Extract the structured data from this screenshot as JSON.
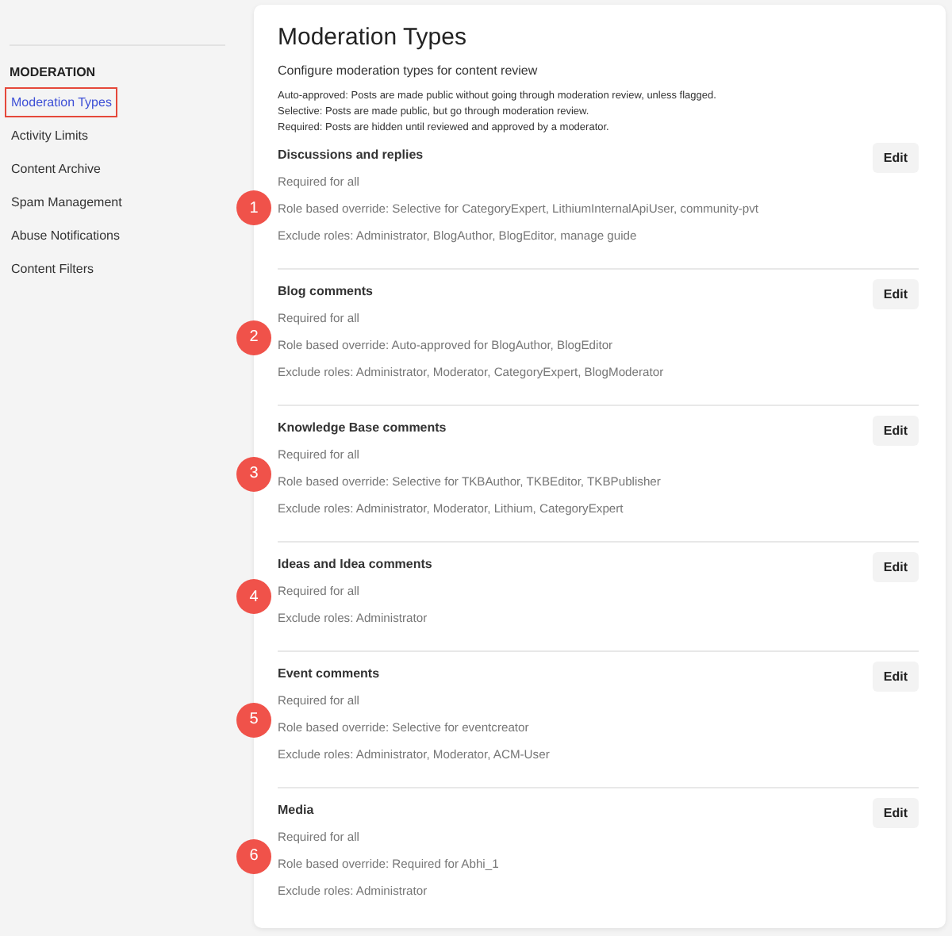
{
  "sidebar": {
    "heading": "MODERATION",
    "items": [
      {
        "label": "Moderation Types",
        "selected": true
      },
      {
        "label": "Activity Limits",
        "selected": false
      },
      {
        "label": "Content Archive",
        "selected": false
      },
      {
        "label": "Spam Management",
        "selected": false
      },
      {
        "label": "Abuse Notifications",
        "selected": false
      },
      {
        "label": "Content Filters",
        "selected": false
      }
    ]
  },
  "page": {
    "title": "Moderation Types",
    "subtitle": "Configure moderation types for content review",
    "definitions": [
      "Auto-approved: Posts are made public without going through moderation review, unless flagged.",
      "Selective: Posts are made public, but go through moderation review.",
      "Required: Posts are hidden until reviewed and approved by a moderator."
    ]
  },
  "sections": [
    {
      "badge": "1",
      "title": "Discussions and replies",
      "button": "Edit",
      "lines": [
        "Required for all",
        "Role based override: Selective for CategoryExpert, LithiumInternalApiUser, community-pvt",
        "Exclude roles: Administrator, BlogAuthor, BlogEditor, manage guide"
      ]
    },
    {
      "badge": "2",
      "title": "Blog comments",
      "button": "Edit",
      "lines": [
        "Required for all",
        "Role based override: Auto-approved for BlogAuthor, BlogEditor",
        "Exclude roles: Administrator, Moderator, CategoryExpert, BlogModerator"
      ]
    },
    {
      "badge": "3",
      "title": "Knowledge Base comments",
      "button": "Edit",
      "lines": [
        "Required for all",
        "Role based override: Selective for TKBAuthor, TKBEditor, TKBPublisher",
        "Exclude roles: Administrator, Moderator, Lithium, CategoryExpert"
      ]
    },
    {
      "badge": "4",
      "title": "Ideas and Idea comments",
      "button": "Edit",
      "lines": [
        "Required for all",
        "Exclude roles: Administrator"
      ]
    },
    {
      "badge": "5",
      "title": "Event comments",
      "button": "Edit",
      "lines": [
        "Required for all",
        "Role based override: Selective for eventcreator",
        "Exclude roles: Administrator, Moderator, ACM-User"
      ]
    },
    {
      "badge": "6",
      "title": "Media",
      "button": "Edit",
      "lines": [
        "Required for all",
        "Role based override: Required for Abhi_1",
        "Exclude roles: Administrator"
      ]
    }
  ]
}
